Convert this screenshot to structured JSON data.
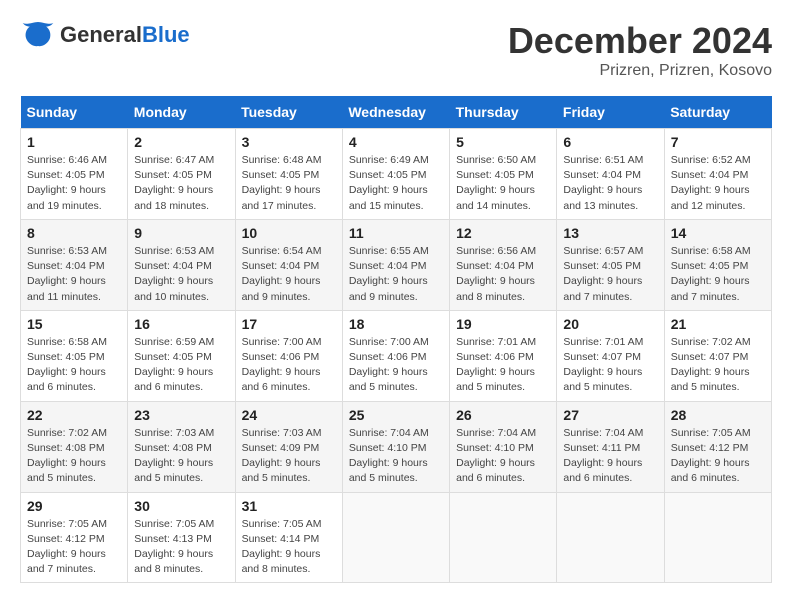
{
  "header": {
    "logo_text_general": "General",
    "logo_text_blue": "Blue",
    "month_title": "December 2024",
    "location": "Prizren, Prizren, Kosovo"
  },
  "weekdays": [
    "Sunday",
    "Monday",
    "Tuesday",
    "Wednesday",
    "Thursday",
    "Friday",
    "Saturday"
  ],
  "weeks": [
    [
      {
        "day": "1",
        "sunrise": "6:46 AM",
        "sunset": "4:05 PM",
        "daylight": "9 hours and 19 minutes."
      },
      {
        "day": "2",
        "sunrise": "6:47 AM",
        "sunset": "4:05 PM",
        "daylight": "9 hours and 18 minutes."
      },
      {
        "day": "3",
        "sunrise": "6:48 AM",
        "sunset": "4:05 PM",
        "daylight": "9 hours and 17 minutes."
      },
      {
        "day": "4",
        "sunrise": "6:49 AM",
        "sunset": "4:05 PM",
        "daylight": "9 hours and 15 minutes."
      },
      {
        "day": "5",
        "sunrise": "6:50 AM",
        "sunset": "4:05 PM",
        "daylight": "9 hours and 14 minutes."
      },
      {
        "day": "6",
        "sunrise": "6:51 AM",
        "sunset": "4:04 PM",
        "daylight": "9 hours and 13 minutes."
      },
      {
        "day": "7",
        "sunrise": "6:52 AM",
        "sunset": "4:04 PM",
        "daylight": "9 hours and 12 minutes."
      }
    ],
    [
      {
        "day": "8",
        "sunrise": "6:53 AM",
        "sunset": "4:04 PM",
        "daylight": "9 hours and 11 minutes."
      },
      {
        "day": "9",
        "sunrise": "6:53 AM",
        "sunset": "4:04 PM",
        "daylight": "9 hours and 10 minutes."
      },
      {
        "day": "10",
        "sunrise": "6:54 AM",
        "sunset": "4:04 PM",
        "daylight": "9 hours and 9 minutes."
      },
      {
        "day": "11",
        "sunrise": "6:55 AM",
        "sunset": "4:04 PM",
        "daylight": "9 hours and 9 minutes."
      },
      {
        "day": "12",
        "sunrise": "6:56 AM",
        "sunset": "4:04 PM",
        "daylight": "9 hours and 8 minutes."
      },
      {
        "day": "13",
        "sunrise": "6:57 AM",
        "sunset": "4:05 PM",
        "daylight": "9 hours and 7 minutes."
      },
      {
        "day": "14",
        "sunrise": "6:58 AM",
        "sunset": "4:05 PM",
        "daylight": "9 hours and 7 minutes."
      }
    ],
    [
      {
        "day": "15",
        "sunrise": "6:58 AM",
        "sunset": "4:05 PM",
        "daylight": "9 hours and 6 minutes."
      },
      {
        "day": "16",
        "sunrise": "6:59 AM",
        "sunset": "4:05 PM",
        "daylight": "9 hours and 6 minutes."
      },
      {
        "day": "17",
        "sunrise": "7:00 AM",
        "sunset": "4:06 PM",
        "daylight": "9 hours and 6 minutes."
      },
      {
        "day": "18",
        "sunrise": "7:00 AM",
        "sunset": "4:06 PM",
        "daylight": "9 hours and 5 minutes."
      },
      {
        "day": "19",
        "sunrise": "7:01 AM",
        "sunset": "4:06 PM",
        "daylight": "9 hours and 5 minutes."
      },
      {
        "day": "20",
        "sunrise": "7:01 AM",
        "sunset": "4:07 PM",
        "daylight": "9 hours and 5 minutes."
      },
      {
        "day": "21",
        "sunrise": "7:02 AM",
        "sunset": "4:07 PM",
        "daylight": "9 hours and 5 minutes."
      }
    ],
    [
      {
        "day": "22",
        "sunrise": "7:02 AM",
        "sunset": "4:08 PM",
        "daylight": "9 hours and 5 minutes."
      },
      {
        "day": "23",
        "sunrise": "7:03 AM",
        "sunset": "4:08 PM",
        "daylight": "9 hours and 5 minutes."
      },
      {
        "day": "24",
        "sunrise": "7:03 AM",
        "sunset": "4:09 PM",
        "daylight": "9 hours and 5 minutes."
      },
      {
        "day": "25",
        "sunrise": "7:04 AM",
        "sunset": "4:10 PM",
        "daylight": "9 hours and 5 minutes."
      },
      {
        "day": "26",
        "sunrise": "7:04 AM",
        "sunset": "4:10 PM",
        "daylight": "9 hours and 6 minutes."
      },
      {
        "day": "27",
        "sunrise": "7:04 AM",
        "sunset": "4:11 PM",
        "daylight": "9 hours and 6 minutes."
      },
      {
        "day": "28",
        "sunrise": "7:05 AM",
        "sunset": "4:12 PM",
        "daylight": "9 hours and 6 minutes."
      }
    ],
    [
      {
        "day": "29",
        "sunrise": "7:05 AM",
        "sunset": "4:12 PM",
        "daylight": "9 hours and 7 minutes."
      },
      {
        "day": "30",
        "sunrise": "7:05 AM",
        "sunset": "4:13 PM",
        "daylight": "9 hours and 8 minutes."
      },
      {
        "day": "31",
        "sunrise": "7:05 AM",
        "sunset": "4:14 PM",
        "daylight": "9 hours and 8 minutes."
      },
      null,
      null,
      null,
      null
    ]
  ]
}
